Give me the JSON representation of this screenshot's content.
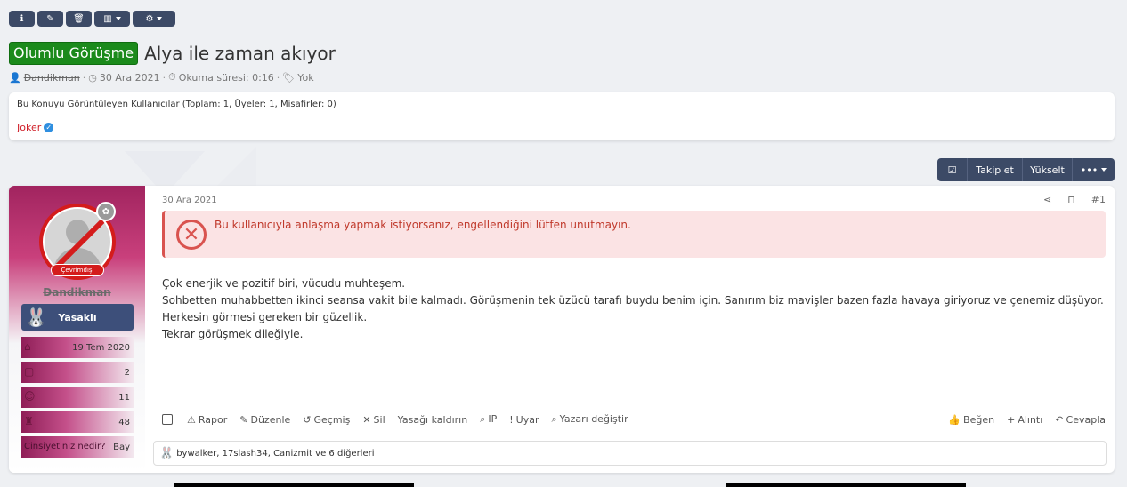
{
  "toolbar": {
    "info_icon": "info-icon",
    "edit_icon": "edit-icon",
    "delete_icon": "trash-icon",
    "stats_icon": "chart-icon",
    "settings_icon": "gear-icon"
  },
  "thread": {
    "prefix": "Olumlu Görüşme",
    "title": "Alya ile zaman akıyor",
    "author": "Dandikman",
    "date": "30 Ara 2021",
    "read_time": "Okuma süresi: 0:16",
    "tags": "Yok"
  },
  "viewers": {
    "title": "Bu Konuyu Görüntüleyen Kullanıcılar (Toplam: 1, Üyeler: 1, Misafirler: 0)",
    "user": "Joker"
  },
  "actions": {
    "follow": "Takip et",
    "bump": "Yükselt"
  },
  "post": {
    "date": "30 Ara 2021",
    "number": "#1",
    "alert": "Bu kullanıcıyla anlaşma yapmak istiyorsanız, engellendiğini lütfen unutmayın.",
    "body": [
      "Çok enerjik ve pozitif biri, vücudu muhteşem.",
      "Sohbetten muhabbetten ikinci seansa vakit bile kalmadı. Görüşmenin tek üzücü tarafı buydu benim için. Sanırım biz mavişler bazen fazla havaya giriyoruz ve çenemiz düşüyor.",
      "Herkesin görmesi gereken bir güzellik.",
      "Tekrar görüşmek dileğiyle."
    ],
    "actions_left": [
      "Rapor",
      "Düzenle",
      "Geçmiş",
      "Sil",
      "Yasağı kaldırın",
      "IP",
      "Uyar",
      "Yazarı değiştir"
    ],
    "actions_right": [
      "Beğen",
      "Alıntı",
      "Cevapla"
    ],
    "reactions": "bywalker, 17slash34, Canizmit ve 6 diğerleri"
  },
  "user": {
    "name": "Dandikman",
    "status": "Çevrimdışı",
    "banner": "Yasaklı",
    "joined": "19 Tem 2020",
    "messages": "2",
    "reactions": "11",
    "points": "48",
    "gender_label": "Cinsiyetiniz nedir?",
    "gender": "Bay"
  }
}
